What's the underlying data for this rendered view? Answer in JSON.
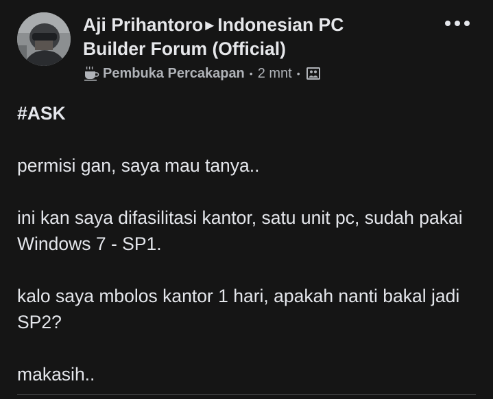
{
  "post": {
    "author": "Aji Prihantoro",
    "group": "Indonesian PC Builder Forum (Official)",
    "badge_label": "Pembuka Percakapan",
    "time": "2 mnt",
    "hashtag": "#ASK",
    "paragraphs": [
      "permisi gan, saya mau tanya..",
      "ini kan saya difasilitasi kantor, satu unit pc, sudah pakai Windows 7 - SP1.",
      "kalo saya mbolos kantor 1 hari, apakah nanti bakal jadi SP2?",
      "makasih.."
    ]
  },
  "icons": {
    "badge": "coffee-cup-icon",
    "audience": "group-photo-icon",
    "more": "more-options-icon",
    "arrow": "right-triangle-icon"
  },
  "colors": {
    "background": "#151515",
    "text_primary": "#e4e6eb",
    "text_secondary": "#b0b3b8"
  }
}
